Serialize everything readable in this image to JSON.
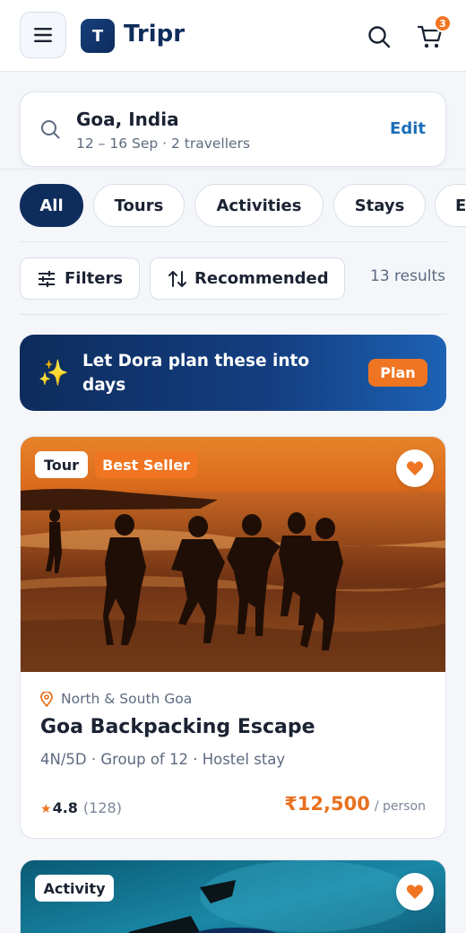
{
  "header": {
    "logo_letter": "T",
    "brand": "Tripr",
    "cart_count": "3",
    "icons": [
      "menu-icon",
      "search-icon",
      "cart-icon"
    ]
  },
  "search": {
    "destination": "Goa, India",
    "details": "12 – 16 Sep · 2 travellers",
    "edit_label": "Edit"
  },
  "chips": [
    {
      "label": "All",
      "active": true
    },
    {
      "label": "Tours",
      "active": false
    },
    {
      "label": "Activities",
      "active": false
    },
    {
      "label": "Stays",
      "active": false
    },
    {
      "label": "E",
      "active": false
    }
  ],
  "filters": {
    "filters_label": "Filters",
    "sort_label": "Recommended",
    "results": "13 results"
  },
  "promo": {
    "text": "Let Dora plan these into days",
    "button": "Plan",
    "icon": "sparkle-icon"
  },
  "listings": [
    {
      "type_badge": "Tour",
      "extra_badge": "Best Seller",
      "location": "North & South Goa",
      "title": "Goa Backpacking Escape",
      "meta": "4N/5D · Group of 12 · Hostel stay",
      "rating": "4.8",
      "reviews": "(128)",
      "price": "₹12,500",
      "price_unit": "/ person",
      "favorited": true
    },
    {
      "type_badge": "Activity",
      "favorited": true
    }
  ],
  "colors": {
    "navy": "#0f2d5c",
    "accent_orange": "#f07523",
    "link_blue": "#1d6fb8"
  }
}
